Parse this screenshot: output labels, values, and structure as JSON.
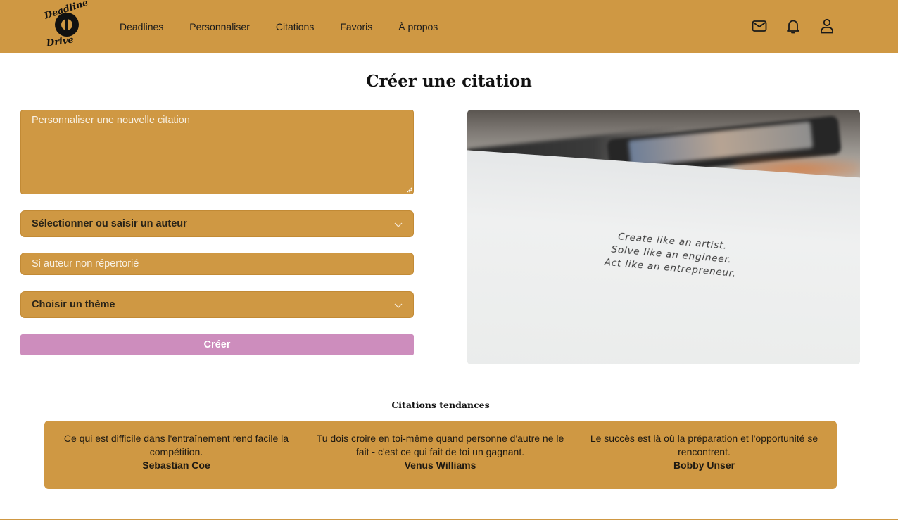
{
  "brand": {
    "logo_top_word": "Deadline",
    "logo_bottom_word": "Drive"
  },
  "nav": {
    "items": [
      "Deadlines",
      "Personnaliser",
      "Citations",
      "Favoris",
      "À propos"
    ]
  },
  "header_icons": [
    "mail-icon",
    "bell-icon",
    "user-icon"
  ],
  "page": {
    "title": "Créer une citation"
  },
  "form": {
    "quote_placeholder": "Personnaliser une nouvelle citation",
    "author_select": "Sélectionner ou saisir un auteur",
    "custom_author_placeholder": "Si auteur non répertorié",
    "theme_select": "Choisir un thème",
    "create_label": "Créer"
  },
  "photo": {
    "lines": [
      "Create like an artist.",
      "Solve like an engineer.",
      "Act like an entrepreneur."
    ]
  },
  "trending": {
    "title": "Citations tendances",
    "items": [
      {
        "quote": "Ce qui est difficile dans l'entraînement rend facile la compétition.",
        "author": "Sebastian Coe"
      },
      {
        "quote": "Tu dois croire en toi-même quand personne d'autre ne le fait - c'est ce qui fait de toi un gagnant.",
        "author": "Venus Williams"
      },
      {
        "quote": "Le succès est là où la préparation et l'opportunité se rencontrent.",
        "author": "Bobby Unser"
      }
    ]
  },
  "colors": {
    "brand": "#cf9843",
    "button": "#cd8dbd"
  }
}
